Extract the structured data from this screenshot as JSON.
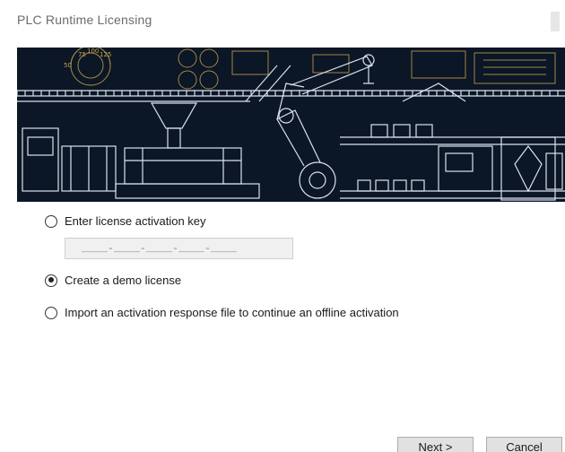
{
  "window": {
    "title": "PLC Runtime Licensing"
  },
  "banner": {
    "gauge_labels": [
      "75",
      "100",
      "125",
      "50"
    ]
  },
  "options": [
    {
      "label": "Enter license activation key",
      "checked": false
    },
    {
      "label": "Create a demo license",
      "checked": true
    },
    {
      "label": "Import an activation response file to continue an offline activation",
      "checked": false
    }
  ],
  "activation_key": {
    "value": "____-____-____-____-____"
  },
  "buttons": {
    "next": "Next >",
    "cancel": "Cancel"
  },
  "colors": {
    "banner_bg": "#0b1626",
    "banner_line": "#d9e3ee",
    "banner_amber": "#c9a44a"
  }
}
